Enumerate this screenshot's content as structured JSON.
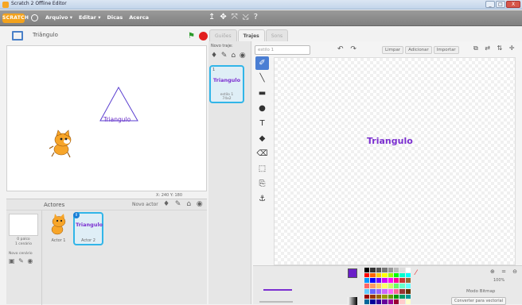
{
  "window": {
    "title": "Scratch 2 Offline Editor",
    "controls": [
      "_",
      "□",
      "X"
    ]
  },
  "menubar": {
    "logo": "SCRATCH",
    "items": [
      "Arquivo ▾",
      "Editar ▾",
      "Dicas",
      "Acerca"
    ],
    "tool_icons": [
      "↥",
      "✥",
      "⤧",
      "⤩",
      "?"
    ]
  },
  "stage": {
    "name": "Triângulo",
    "coords": "X: 240  Y: 180",
    "triangle_label": "Triangulo"
  },
  "sprites": {
    "header_label": "Actores",
    "new_sprite_label": "Novo actor",
    "stage_caption": "0 palco\n1 cenário",
    "new_backdrop_label": "Novo cenário",
    "items": [
      {
        "name": "Actor 1"
      },
      {
        "name": "Actor 2",
        "thumb_text": "Triangulo"
      }
    ]
  },
  "tabs": [
    "Guiões",
    "Trajes",
    "Sons"
  ],
  "active_tab": 1,
  "costumes": {
    "new_label": "Novo traje:",
    "item": {
      "number": "1",
      "thumb_text": "Triangulo",
      "caption": "estilo 1\n74x2"
    }
  },
  "editor": {
    "costume_name_placeholder": "estilo 1",
    "buttons": [
      "Limpar",
      "Adicionar",
      "Importar"
    ],
    "canvas_text": "Triangulo",
    "zoom": "100%",
    "mode_label": "Modo Bitmap",
    "convert_label": "Converter para vectorial"
  },
  "colors": {
    "accent": "#4a7ed3",
    "text_purple": "#7b2fd0",
    "stop": "#e21e1e"
  }
}
